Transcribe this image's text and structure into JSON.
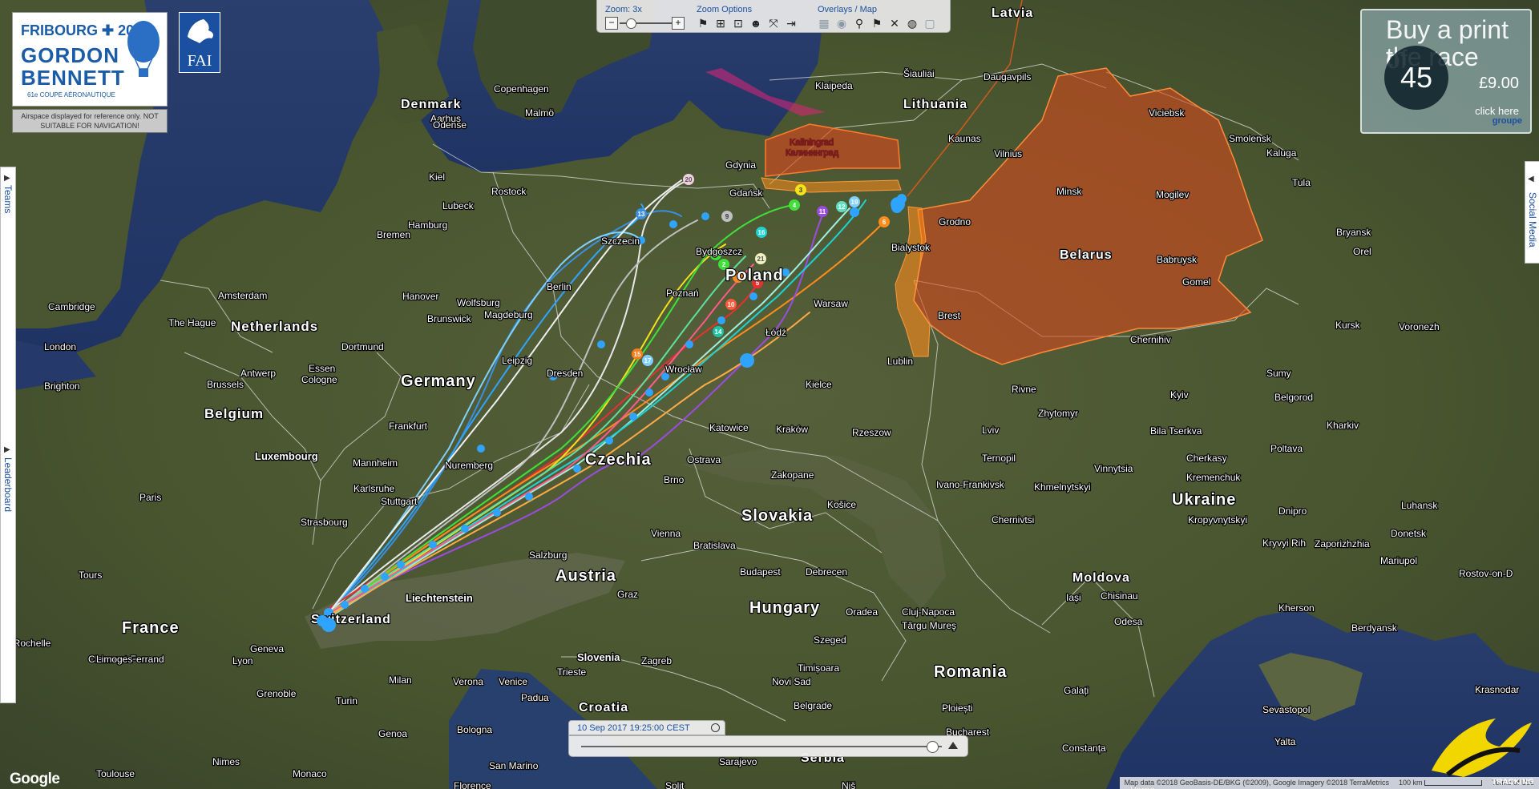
{
  "branding": {
    "event_year_line": "FRIBOURG ✚ 2017",
    "event_line1": "GORDON",
    "event_line2": "BENNETT",
    "event_subtitle": "61e COUPE AÉRONAUTIQUE",
    "airspace_note": "Airspace displayed for reference only. NOT SUITABLE FOR NAVIGATION!",
    "fai_text": "FAI",
    "tracking_brand": "TRACKING"
  },
  "toolbar": {
    "zoom_label": "Zoom: 3x",
    "zoom_minus": "−",
    "zoom_plus": "+",
    "zoom_level": 3,
    "zoom_options_label": "Zoom Options",
    "overlays_label": "Overlays / Map",
    "zoom_icons": [
      "flag-icon",
      "zoom-in-icon",
      "center-icon",
      "group-icon",
      "fullscreen-icon",
      "exit-icon"
    ],
    "overlay_icons": [
      "grid-icon",
      "terrain-icon",
      "wind-icon",
      "flight-path-icon",
      "shuffle-icon",
      "globe-icon",
      "blank-icon"
    ]
  },
  "ad": {
    "line1": "Buy a print of",
    "line2": "the race",
    "price": "£9.00",
    "click": "click here",
    "circle_text": "45",
    "brand": "groupe"
  },
  "side_tabs": {
    "teams": "Teams",
    "leaderboard": "Leaderboard",
    "social": "Social Media"
  },
  "timeline": {
    "datetime": "10 Sep 2017 19:25:00 CEST",
    "progress": 0.97
  },
  "footer": {
    "google": "Google",
    "attribution": "Map data ©2018 GeoBasis-DE/BKG (©2009), Google Imagery ©2018 TerraMetrics",
    "scale": "100 km",
    "terms": "Terms of Use"
  },
  "map": {
    "countries": [
      {
        "name": "Germany"
      },
      {
        "name": "Poland"
      },
      {
        "name": "Czechia"
      },
      {
        "name": "Slovakia"
      },
      {
        "name": "Austria"
      },
      {
        "name": "Hungary"
      },
      {
        "name": "Romania"
      },
      {
        "name": "Ukraine"
      },
      {
        "name": "Belarus"
      },
      {
        "name": "Lithuania"
      },
      {
        "name": "Latvia"
      },
      {
        "name": "France"
      },
      {
        "name": "Belgium"
      },
      {
        "name": "Netherlands"
      },
      {
        "name": "Switzerland"
      },
      {
        "name": "Denmark"
      },
      {
        "name": "Luxembourg"
      },
      {
        "name": "Moldova"
      },
      {
        "name": "Croatia"
      },
      {
        "name": "Serbia"
      },
      {
        "name": "Slovenia"
      },
      {
        "name": "Liechtenstein"
      }
    ],
    "balloon_markers": [
      "1",
      "2",
      "3",
      "4",
      "5",
      "6",
      "7",
      "8",
      "9",
      "10",
      "11",
      "12",
      "13",
      "14",
      "15",
      "16",
      "17",
      "18",
      "19",
      "20",
      "21"
    ],
    "restricted_zones": [
      "Kaliningrad Калининград",
      "Belarus"
    ]
  }
}
